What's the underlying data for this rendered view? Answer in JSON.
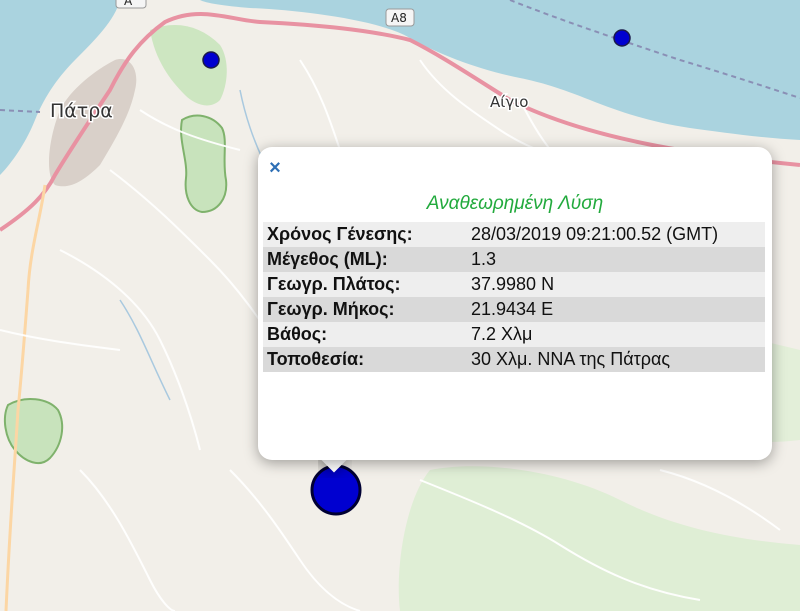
{
  "map": {
    "labels": {
      "patra": "Πάτρα",
      "aigio": "Αίγιο",
      "road": "A8",
      "road_top": "A"
    },
    "colors": {
      "sea": "#aad3df",
      "land": "#f2efe9",
      "green": "#cde6c1",
      "motorway": "#e892a2",
      "primary": "#fcd6a4",
      "urban": "#d9d0c9",
      "marker": "#0000d0"
    }
  },
  "popup": {
    "close_icon": "×",
    "title": "Αναθεωρημένη Λύση",
    "rows": [
      {
        "key": "Χρόνος Γένεσης:",
        "value": "28/03/2019 09:21:00.52 (GMT)"
      },
      {
        "key": "Μέγεθος (ML):",
        "value": "1.3"
      },
      {
        "key": "Γεωγρ. Πλάτος:",
        "value": "37.9980 N"
      },
      {
        "key": "Γεωγρ. Μήκος:",
        "value": "21.9434 E"
      },
      {
        "key": "Βάθος:",
        "value": "7.2 Χλμ"
      },
      {
        "key": "Τοποθεσία:",
        "value": "30 Χλμ. ΝΝΑ της Πάτρας"
      }
    ]
  }
}
